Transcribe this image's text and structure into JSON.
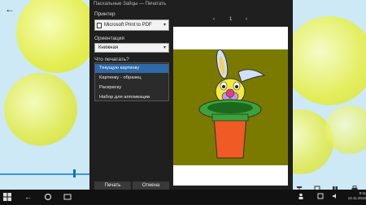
{
  "dialog": {
    "title": "Пасхальные Зайцы — Печатать",
    "printer_label": "Принтер",
    "printer_value": "Microsoft Print to PDF",
    "orientation_label": "Ориентация",
    "orientation_value": "Книжная",
    "what_to_print_label": "Что печатать?",
    "options": [
      "Текущую картинку",
      "Картинку - образец",
      "Раскраску",
      "Набор для аппликации"
    ],
    "selected_option_index": 0,
    "print_button": "Печать",
    "cancel_button": "Отмена"
  },
  "preview": {
    "prev_arrow": "‹",
    "page_number": "1",
    "next_arrow": "›"
  },
  "taskbar": {
    "time": "9:11",
    "date": "14.11.2015"
  },
  "colors": {
    "accent": "#2f6aa8",
    "dialog_bg": "#1f1f1f",
    "picture_bg": "#7a7a00"
  },
  "icons": [
    "back-arrow-icon",
    "printer-icon",
    "chevron-down-icon",
    "windows-start-icon",
    "back-icon",
    "search-icon",
    "task-view-icon"
  ]
}
